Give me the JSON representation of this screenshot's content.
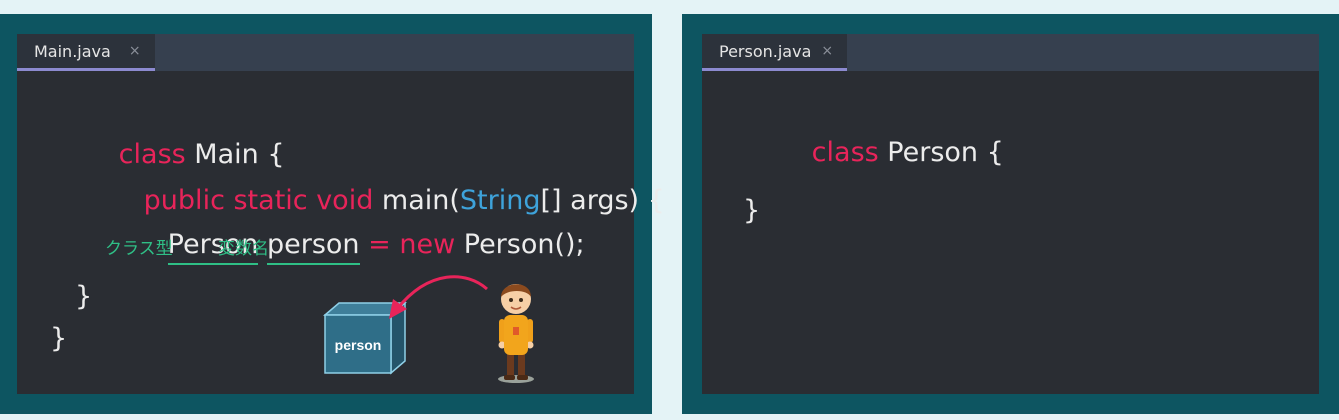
{
  "left_editor": {
    "tab_label": "Main.java",
    "close_glyph": "×",
    "lines": {
      "l1_kw": "class",
      "l1_rest": " Main {",
      "l2_kw": "public static void",
      "l2_a": " main(",
      "l2_type": "String",
      "l2_b": "[] args) {",
      "l3_type_name": "Person",
      "l3_var_name": "person",
      "l3_eq": " = ",
      "l3_new": "new",
      "l3_rest": " Person();",
      "l4": "}",
      "l5": "}"
    },
    "annotations": {
      "class_type": "クラス型",
      "variable_name": "変数名"
    },
    "box_label": "person"
  },
  "right_editor": {
    "tab_label": "Person.java",
    "close_glyph": "×",
    "lines": {
      "l1_kw": "class",
      "l1_rest": " Person {",
      "l2": "}"
    }
  },
  "colors": {
    "keyword": "#e8245a",
    "type": "#3ea3db",
    "annotation": "#2fbf86",
    "editor_bg": "#2a2d33",
    "frame_bg": "#0d5561"
  }
}
